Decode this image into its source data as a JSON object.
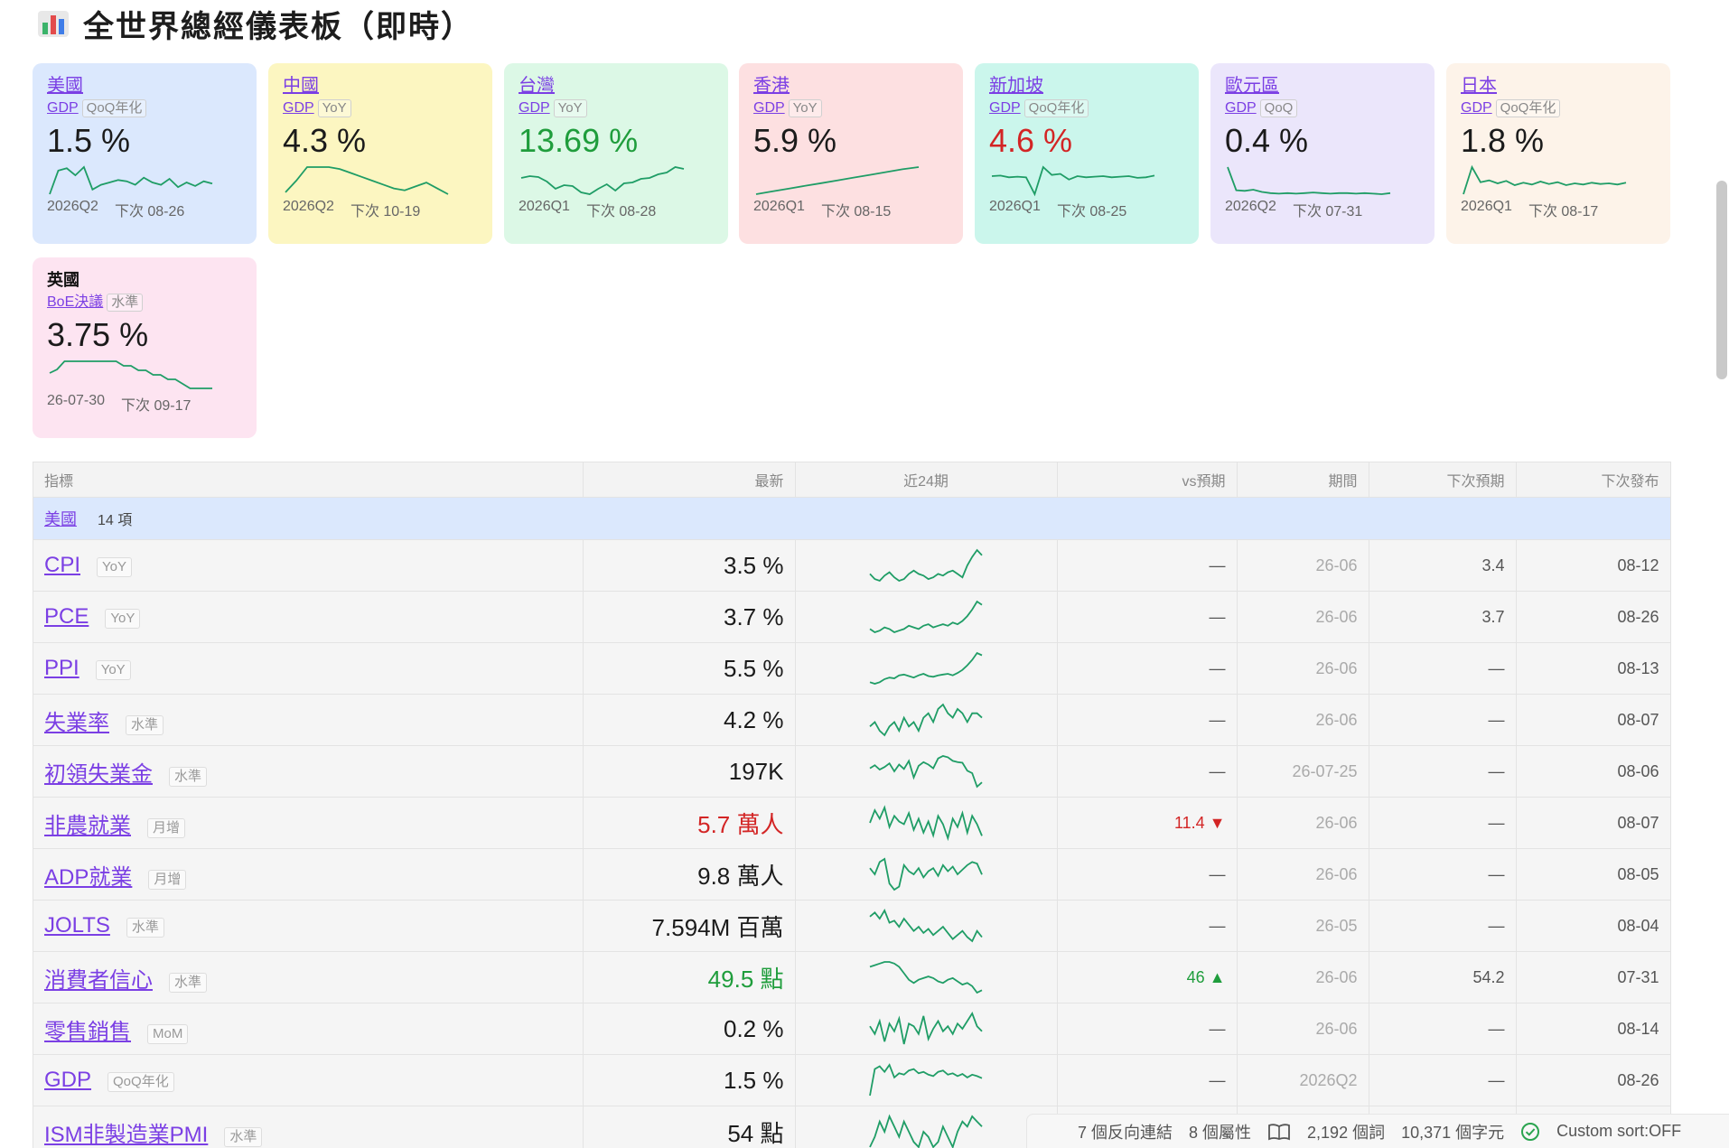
{
  "page": {
    "title": "全世界總經儀表板（即時）",
    "icon": "bar-chart-icon"
  },
  "cards": [
    {
      "country": "美國",
      "indicator": "GDP",
      "tag": "QoQ年化",
      "value": "1.5 %",
      "tone": "normal",
      "period": "2026Q2",
      "next": "下次 08-26",
      "bg": "#dbe8fd",
      "trend": [
        1.2,
        3.2,
        3.4,
        2.8,
        3.5,
        1.6,
        2.0,
        2.2,
        2.4,
        2.3,
        2.0,
        2.6,
        2.2,
        2.0,
        2.5,
        1.8,
        2.2,
        1.9,
        2.3,
        2.1
      ]
    },
    {
      "country": "中國",
      "indicator": "GDP",
      "tag": "YoY",
      "value": "4.3 %",
      "tone": "normal",
      "period": "2026Q2",
      "next": "下次 10-19",
      "bg": "#fcf6c1",
      "trend": [
        5.0,
        5.6,
        6.3,
        6.3,
        6.3,
        6.2,
        6.0,
        5.8,
        5.6,
        5.4,
        5.2,
        5.1,
        5.3,
        5.5,
        5.2,
        4.9
      ]
    },
    {
      "country": "台灣",
      "indicator": "GDP",
      "tag": "YoY",
      "value": "13.69 %",
      "tone": "green",
      "period": "2026Q1",
      "next": "下次 08-28",
      "bg": "#dcf8e6",
      "trend": [
        3.0,
        3.2,
        3.1,
        2.6,
        1.8,
        2.2,
        2.1,
        1.4,
        1.2,
        1.8,
        2.3,
        1.6,
        2.4,
        2.5,
        2.9,
        3.0,
        3.4,
        3.6,
        4.2,
        4.0
      ]
    },
    {
      "country": "香港",
      "indicator": "GDP",
      "tag": "YoY",
      "value": "5.9 %",
      "tone": "normal",
      "period": "2026Q1",
      "next": "下次 08-15",
      "bg": "#fde0e1",
      "trend": [
        1.0,
        1.5,
        2.0,
        2.5,
        3.0,
        3.5,
        4.0,
        4.5,
        5.0,
        5.5,
        5.9
      ]
    },
    {
      "country": "新加坡",
      "indicator": "GDP",
      "tag": "QoQ年化",
      "value": "4.6 %",
      "tone": "red",
      "period": "2026Q1",
      "next": "下次 08-25",
      "bg": "#cbf6ec",
      "trend": [
        2.2,
        2.3,
        2.0,
        2.1,
        2.0,
        -1.0,
        3.8,
        2.4,
        2.6,
        1.6,
        2.2,
        2.0,
        2.1,
        2.2,
        2.0,
        2.1,
        2.2,
        1.9,
        2.0,
        2.3
      ]
    },
    {
      "country": "歐元區",
      "indicator": "GDP",
      "tag": "QoQ",
      "value": "0.4 %",
      "tone": "normal",
      "period": "2026Q2",
      "next": "下次 07-31",
      "bg": "#ebe6fb",
      "trend": [
        5.0,
        0.9,
        0.8,
        1.0,
        0.6,
        0.4,
        0.3,
        0.4,
        0.3,
        0.4,
        0.5,
        0.4,
        0.3,
        0.4,
        0.4,
        0.3,
        0.4,
        0.3,
        0.2,
        0.4
      ]
    },
    {
      "country": "日本",
      "indicator": "GDP",
      "tag": "QoQ年化",
      "value": "1.8 %",
      "tone": "normal",
      "period": "2026Q1",
      "next": "下次 08-17",
      "bg": "#fdf3e9",
      "trend": [
        1.0,
        5.5,
        3.0,
        3.3,
        2.8,
        3.2,
        2.5,
        2.9,
        2.6,
        3.1,
        2.7,
        3.0,
        2.5,
        2.8,
        2.6,
        2.9,
        2.7,
        2.8,
        2.6,
        2.9
      ]
    },
    {
      "country": "英國",
      "indicator": "BoE決議",
      "tag": "水準",
      "value": "3.75 %",
      "tone": "normal",
      "period": "26-07-30",
      "next": "下次 09-17",
      "bg": "#fde4f1",
      "plain": true,
      "trend": [
        4.6,
        4.8,
        5.25,
        5.25,
        5.25,
        5.25,
        5.25,
        5.25,
        5.25,
        5.25,
        5.0,
        5.0,
        4.75,
        4.75,
        4.5,
        4.5,
        4.25,
        4.25,
        4.0,
        3.75,
        3.75,
        3.75,
        3.75
      ]
    }
  ],
  "table": {
    "headers": {
      "indicator": "指標",
      "latest": "最新",
      "trend": "近24期",
      "vs": "vs預期",
      "period": "期間",
      "next_forecast": "下次預期",
      "next_release": "下次發布"
    },
    "group": {
      "name": "美國",
      "count": "14 項"
    },
    "rows": [
      {
        "name": "CPI",
        "tag": "YoY",
        "latest": "3.5 %",
        "tone": "normal",
        "vs": "—",
        "vs_tone": "none",
        "period": "26-06",
        "forecast": "3.4",
        "release": "08-12",
        "trend": [
          2.4,
          2.1,
          2.0,
          2.3,
          2.5,
          2.2,
          2.0,
          2.1,
          2.4,
          2.6,
          2.4,
          2.3,
          2.1,
          2.2,
          2.4,
          2.3,
          2.5,
          2.6,
          2.4,
          2.2,
          2.9,
          3.4,
          3.8,
          3.5
        ]
      },
      {
        "name": "PCE",
        "tag": "YoY",
        "latest": "3.7 %",
        "tone": "normal",
        "vs": "—",
        "vs_tone": "none",
        "period": "26-06",
        "forecast": "3.7",
        "release": "08-26",
        "trend": [
          2.2,
          2.0,
          2.1,
          2.3,
          2.2,
          2.0,
          2.1,
          2.2,
          2.4,
          2.3,
          2.2,
          2.4,
          2.5,
          2.3,
          2.4,
          2.5,
          2.4,
          2.6,
          2.5,
          2.7,
          3.0,
          3.4,
          3.9,
          3.7
        ]
      },
      {
        "name": "PPI",
        "tag": "YoY",
        "latest": "5.5 %",
        "tone": "normal",
        "vs": "—",
        "vs_tone": "none",
        "period": "26-06",
        "forecast": "—",
        "release": "08-13",
        "trend": [
          2.0,
          1.8,
          2.0,
          2.4,
          2.6,
          2.5,
          2.9,
          3.0,
          2.8,
          2.6,
          2.9,
          3.1,
          2.8,
          2.7,
          2.9,
          3.0,
          3.1,
          2.9,
          3.2,
          3.6,
          4.2,
          4.9,
          5.8,
          5.5
        ]
      },
      {
        "name": "失業率",
        "tag": "水準",
        "latest": "4.2 %",
        "tone": "normal",
        "vs": "—",
        "vs_tone": "none",
        "period": "26-06",
        "forecast": "—",
        "release": "08-07",
        "trend": [
          4.0,
          4.1,
          3.9,
          3.8,
          4.0,
          4.1,
          3.9,
          4.2,
          4.0,
          4.1,
          3.9,
          4.2,
          4.3,
          4.1,
          4.4,
          4.5,
          4.3,
          4.2,
          4.4,
          4.3,
          4.1,
          4.3,
          4.3,
          4.2
        ]
      },
      {
        "name": "初領失業金",
        "tag": "水準",
        "latest": "197K",
        "tone": "normal",
        "vs": "—",
        "vs_tone": "none",
        "period": "26-07-25",
        "forecast": "—",
        "release": "08-06",
        "trend": [
          220,
          225,
          218,
          222,
          228,
          215,
          226,
          219,
          232,
          205,
          224,
          230,
          226,
          220,
          236,
          240,
          238,
          232,
          230,
          229,
          216,
          212,
          190,
          197
        ]
      },
      {
        "name": "非農就業",
        "tag": "月增",
        "latest": "5.7 萬人",
        "tone": "red",
        "vs": "11.4 ▼",
        "vs_tone": "red",
        "period": "26-06",
        "forecast": "—",
        "release": "08-07",
        "trend": [
          15,
          24,
          18,
          26,
          12,
          20,
          16,
          14,
          22,
          10,
          18,
          8,
          16,
          6,
          20,
          14,
          4,
          18,
          12,
          22,
          8,
          20,
          14,
          5.7
        ]
      },
      {
        "name": "ADP就業",
        "tag": "月增",
        "latest": "9.8 萬人",
        "tone": "normal",
        "vs": "—",
        "vs_tone": "none",
        "period": "26-06",
        "forecast": "—",
        "release": "08-05",
        "trend": [
          14,
          10,
          18,
          20,
          4,
          0,
          2,
          16,
          12,
          10,
          14,
          8,
          12,
          14,
          9,
          16,
          12,
          15,
          10,
          13,
          16,
          18,
          17,
          9.8
        ]
      },
      {
        "name": "JOLTS",
        "tag": "水準",
        "latest": "7.594M 百萬",
        "tone": "normal",
        "vs": "—",
        "vs_tone": "none",
        "period": "26-05",
        "forecast": "—",
        "release": "08-04",
        "trend": [
          8.6,
          8.8,
          8.5,
          8.9,
          8.3,
          8.4,
          8.1,
          8.5,
          8.2,
          7.9,
          8.1,
          7.8,
          8.0,
          7.7,
          7.9,
          8.1,
          7.8,
          7.5,
          7.7,
          7.9,
          7.6,
          7.4,
          7.9,
          7.6
        ]
      },
      {
        "name": "消費者信心",
        "tag": "水準",
        "latest": "49.5 點",
        "tone": "green",
        "vs": "46 ▲",
        "vs_tone": "green",
        "period": "26-06",
        "forecast": "54.2",
        "release": "07-31",
        "trend": [
          64,
          65,
          66,
          67,
          67,
          66,
          64,
          60,
          56,
          54,
          56,
          57,
          58,
          57,
          55,
          54,
          56,
          57,
          55,
          53,
          54,
          52,
          48,
          49.5
        ]
      },
      {
        "name": "零售銷售",
        "tag": "MoM",
        "latest": "0.2 %",
        "tone": "normal",
        "vs": "—",
        "vs_tone": "none",
        "period": "26-06",
        "forecast": "—",
        "release": "08-14",
        "trend": [
          0.4,
          0.1,
          0.6,
          -0.2,
          0.5,
          0.2,
          0.7,
          -0.3,
          0.5,
          0.4,
          0.1,
          0.8,
          -0.1,
          0.3,
          0.6,
          0.2,
          0.4,
          0.1,
          0.5,
          0.3,
          0.6,
          0.9,
          0.4,
          0.2
        ]
      },
      {
        "name": "GDP",
        "tag": "QoQ年化",
        "latest": "1.5 %",
        "tone": "normal",
        "vs": "—",
        "vs_tone": "none",
        "period": "2026Q2",
        "forecast": "—",
        "release": "08-26",
        "trend": [
          -1.0,
          2.8,
          3.2,
          2.4,
          3.4,
          1.6,
          2.2,
          2.0,
          2.6,
          2.8,
          2.2,
          2.4,
          2.0,
          1.8,
          2.4,
          2.6,
          2.0,
          2.2,
          1.8,
          2.1,
          1.6,
          2.0,
          1.8,
          1.5
        ]
      },
      {
        "name": "ISM非製造業PMI",
        "tag": "水準",
        "latest": "54 點",
        "tone": "normal",
        "vs": "",
        "vs_tone": "none",
        "period": "",
        "forecast": "",
        "release": "",
        "trend": [
          50,
          52,
          55,
          53,
          56,
          54,
          52,
          55,
          53,
          51,
          50,
          53,
          52,
          50,
          51,
          54,
          52,
          50,
          53,
          55,
          54,
          56,
          55,
          54
        ]
      }
    ]
  },
  "status_bar": {
    "backlinks": "7 個反向連結",
    "properties": "8 個屬性",
    "words": "2,192 個詞",
    "chars": "10,371 個字元",
    "sort": "Custom sort:OFF"
  },
  "colors": {
    "spark": "#1f9d66",
    "link": "#7b3fe4",
    "up": "#1f9d3c",
    "down": "#d32525"
  }
}
